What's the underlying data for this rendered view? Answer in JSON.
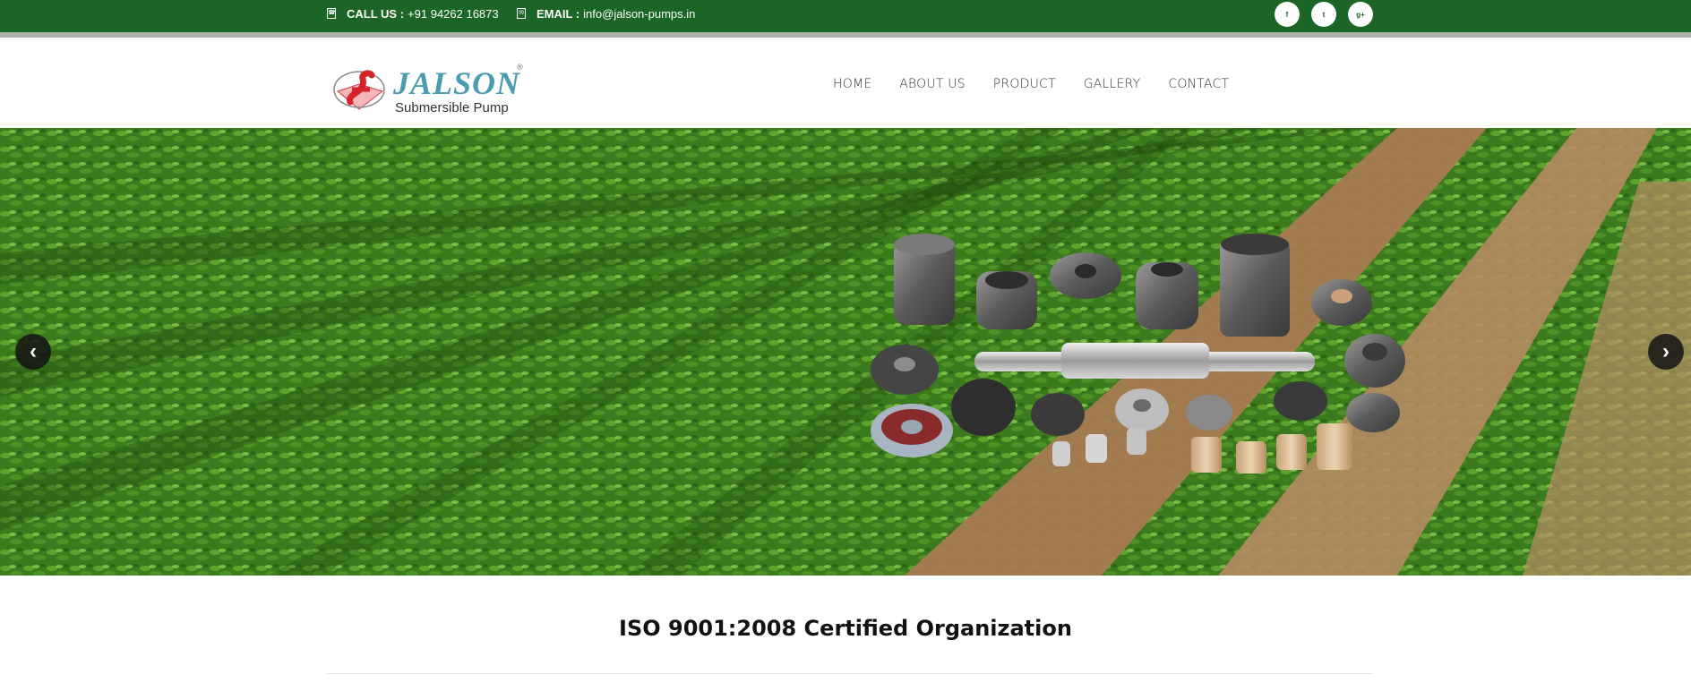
{
  "topbar": {
    "call_label": "CALL US :",
    "phone": "+91 94262 16873",
    "email_label": "EMAIL :",
    "email": "info@jalson-pumps.in",
    "contact_icon": "phone-icon",
    "email_icon": "mail-icon",
    "socials": [
      {
        "icon": "facebook-icon"
      },
      {
        "icon": "twitter-icon"
      },
      {
        "icon": "googleplus-icon"
      }
    ]
  },
  "logo": {
    "name": "JALSON",
    "registered": "®",
    "tagline": "Submersible Pump"
  },
  "nav": {
    "items": [
      {
        "label": "HOME"
      },
      {
        "label": "ABOUT US"
      },
      {
        "label": "PRODUCT"
      },
      {
        "label": "GALLERY"
      },
      {
        "label": "CONTACT"
      }
    ]
  },
  "slider": {
    "prev_icon": "chevron-left-icon",
    "next_icon": "chevron-right-icon"
  },
  "section": {
    "title": "ISO 9001:2008 Certified Organization"
  },
  "colors": {
    "topbar": "#1b6526",
    "logo_blue": "#4a9bb0",
    "logo_red": "#d4232b"
  }
}
